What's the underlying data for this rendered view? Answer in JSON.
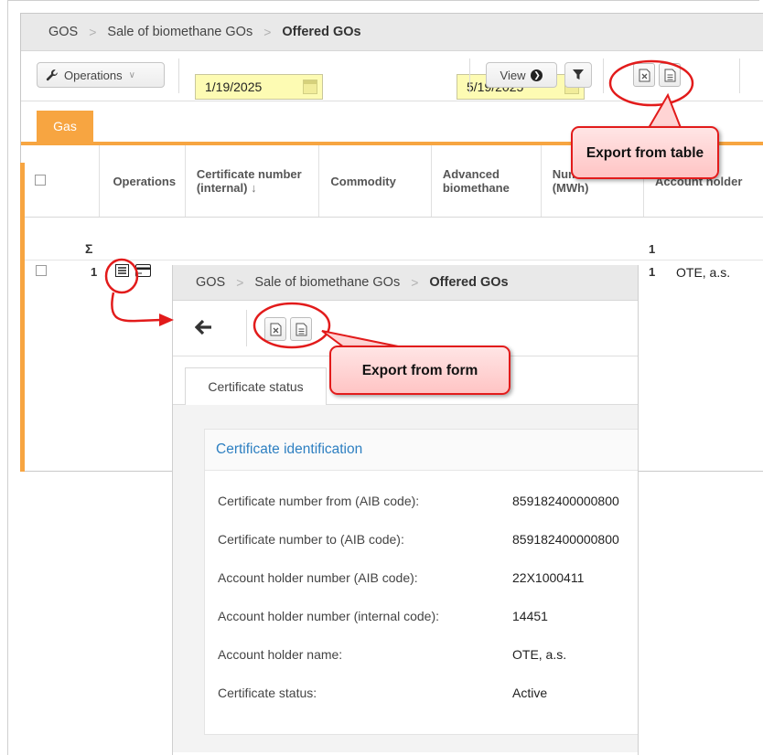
{
  "main": {
    "breadcrumb": [
      "GOS",
      "Sale of biomethane GOs",
      "Offered GOs"
    ],
    "toolbar": {
      "operations_label": "Operations",
      "date_from": "1/19/2025",
      "date_to": "5/19/2025",
      "view_label": "View"
    },
    "tab_label": "Gas",
    "columns": [
      "Operations",
      "Certificate number (internal)",
      "Commodity",
      "Advanced biomethane",
      "Number of GO (MWh)",
      "Account holder"
    ],
    "column_sort_marker": "↓",
    "sum_symbol": "Σ",
    "sum_value": "1",
    "row": {
      "index": "1",
      "number_go": "1",
      "account_holder": "OTE, a.s."
    }
  },
  "form": {
    "breadcrumb": [
      "GOS",
      "Sale of biomethane GOs",
      "Offered GOs"
    ],
    "tab_label": "Certificate status",
    "section_title": "Certificate identification",
    "fields": [
      {
        "label": "Certificate number from (AIB code):",
        "value": "859182400000800"
      },
      {
        "label": "Certificate number to (AIB code):",
        "value": "859182400000800"
      },
      {
        "label": "Account holder number (AIB code):",
        "value": "22X1000411"
      },
      {
        "label": "Account holder number (internal code):",
        "value": "14451"
      },
      {
        "label": "Account holder name:",
        "value": "OTE, a.s."
      },
      {
        "label": "Certificate status:",
        "value": "Active"
      }
    ]
  },
  "callouts": {
    "export_table": "Export from table",
    "export_form": "Export from form"
  },
  "colors": {
    "accent_orange": "#f7a541",
    "date_yellow": "#fdfbb3",
    "callout_red": "#e21b1b",
    "link_blue": "#2d7fc1"
  }
}
